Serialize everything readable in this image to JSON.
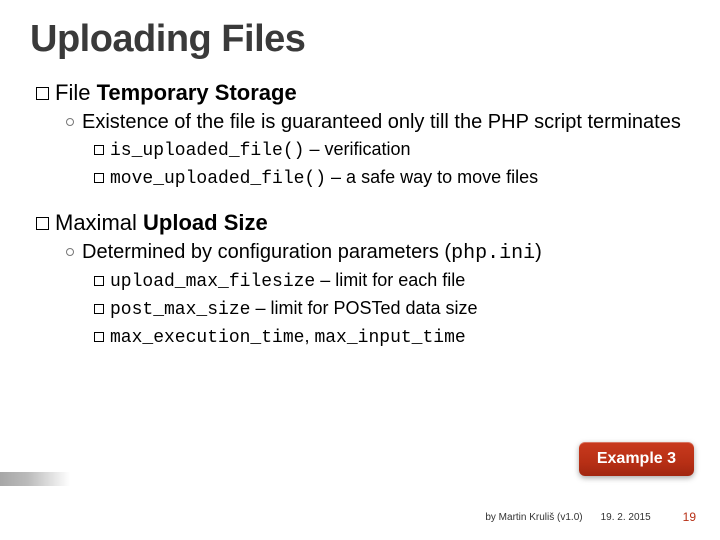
{
  "title": "Uploading Files",
  "sec1": {
    "heading_a": "File",
    "heading_b": "Temporary Storage",
    "point": "Existence of the file is guaranteed only till the PHP script terminates",
    "b1_code": "is_uploaded_file()",
    "b1_txt": " – verification",
    "b2_code": "move_uploaded_file()",
    "b2_txt": " – a safe way to move files"
  },
  "sec2": {
    "heading_a": "Maximal",
    "heading_b": "Upload Size",
    "point_a": "Determined by configuration parameters (",
    "point_code": "php.ini",
    "point_b": ")",
    "b1_code": "upload_max_filesize",
    "b1_txt": " – limit for each file",
    "b2_code": "post_max_size",
    "b2_txt": " – limit for POSTed data size",
    "b3_code": "max_execution_time",
    "b3_sep": ", ",
    "b3_code2": "max_input_time"
  },
  "badge": "Example 3",
  "footer": {
    "author": "by Martin Kruliš (v1.0)",
    "date": "19. 2. 2015",
    "page": "19"
  }
}
